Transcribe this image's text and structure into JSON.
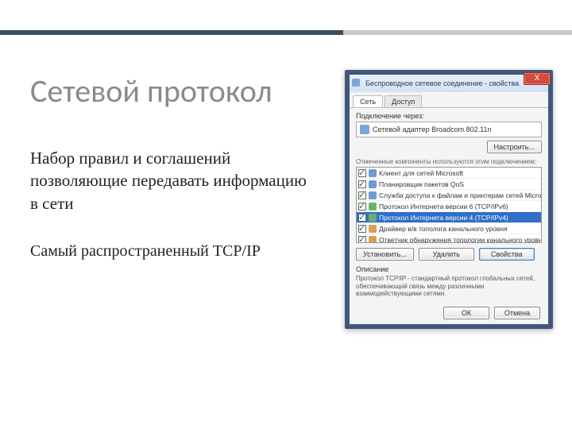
{
  "slide": {
    "title": "Сетевой протокол",
    "definition": "Набор правил и соглашений позволяющие передавать информацию в сети",
    "popular": "Самый распространенный TCP/IP"
  },
  "dialog": {
    "title": "Беспроводное сетевое соединение - свойства",
    "close_x": "X",
    "tabs": {
      "net": "Сеть",
      "access": "Доступ"
    },
    "connect_via_label": "Подключение через:",
    "adapter": "Сетевой адаптер Broadcom 802.11n",
    "configure_btn": "Настроить...",
    "components_note": "Отмеченные компоненты используются этим подключением:",
    "items": [
      {
        "checked": true,
        "label": "Клиент для сетей Microsoft"
      },
      {
        "checked": true,
        "label": "Планировщик пакетов QoS"
      },
      {
        "checked": true,
        "label": "Служба доступа к файлам и принтерам сетей Micro..."
      },
      {
        "checked": true,
        "label": "Протокол Интернета версии 6 (TCP/IPv6)"
      },
      {
        "checked": true,
        "label": "Протокол Интернета версии 4 (TCP/IPv4)"
      },
      {
        "checked": true,
        "label": "Драйвер в/в тополога канального уровня"
      },
      {
        "checked": true,
        "label": "Ответчик обнаружения топологии канального уровня"
      }
    ],
    "install_btn": "Установить...",
    "uninstall_btn": "Удалить",
    "properties_btn": "Свойства",
    "desc_label": "Описание",
    "desc_text": "Протокол TCP/IP - стандартный протокол глобальных сетей, обеспечивающий связь между различными взаимодействующими сетями.",
    "ok_btn": "ОК",
    "cancel_btn": "Отмена"
  }
}
